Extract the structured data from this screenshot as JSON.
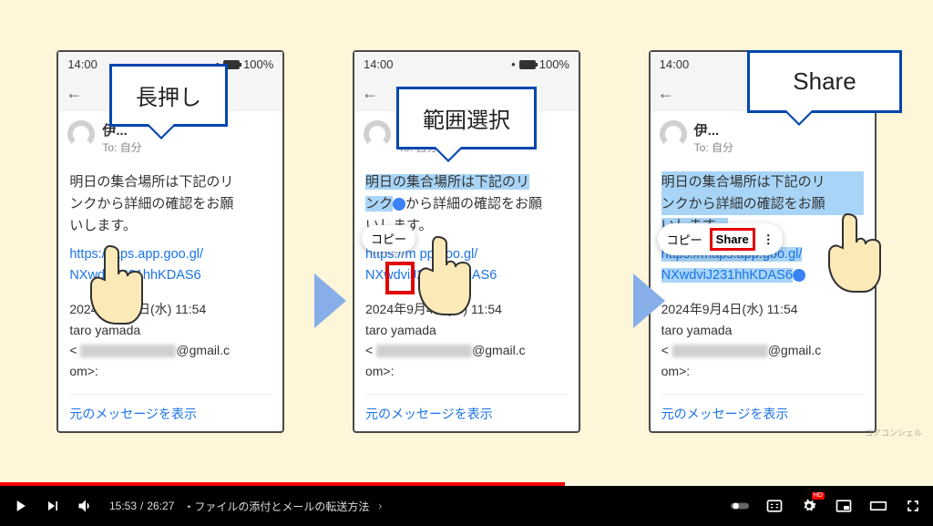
{
  "speech": {
    "s1": "長押し",
    "s2": "範囲選択",
    "s3": "Share"
  },
  "phone": {
    "time": "14:00",
    "battery": "100%",
    "sender_name": "伊...",
    "sender_to": "To: 自分",
    "body_line1": "明日の集合場所は下記のリ",
    "body_line2": "ンクから詳細の確認をお願",
    "body_line3": "いします。",
    "body_p3_line1": "明日の集合場所は下記のリ",
    "body_p3_line2": "ンクから詳細の確認をお願",
    "link_l1": "https://maps.app.goo.gl/",
    "link_l2": "NXwdviJ231hhKDAS6",
    "link_p1_l1": "https://  aps.app.goo.gl/",
    "link_p2_l1": "https://m       pp.goo.gl/",
    "meta_date": "2024年9月4日(水) 11:54",
    "meta_name": "taro yamada",
    "meta_email_pre": "< ",
    "meta_email_post": "@gmail.c",
    "meta_email_line2": "om>:",
    "show_original": "元のメッセージを表示",
    "copy": "コピー",
    "share": "Share",
    "more_dots": "⋮",
    "body_p3_line3_a": "いします。"
  },
  "controls": {
    "current": "15:53",
    "sep": " / ",
    "total": "26:27",
    "chapter": "・ファイルの添付とメールの転送方法",
    "hd": "HD"
  },
  "channel": "コアコンシェル"
}
